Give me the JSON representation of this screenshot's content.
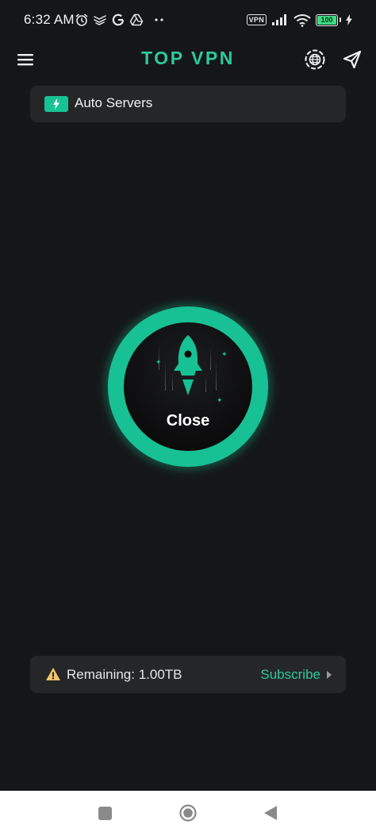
{
  "status_bar": {
    "time": "6:32 AM",
    "left_icons": [
      "alarm-icon",
      "notification-icon",
      "google-icon",
      "drive-icon",
      "more-dots-icon"
    ],
    "vpn_badge": "VPN",
    "battery_level": "100",
    "battery_color": "#3ddc84"
  },
  "header": {
    "title": "TOP VPN",
    "menu_icon": "hamburger-menu-icon",
    "globe_icon": "globe-settings-icon",
    "share_icon": "send-icon"
  },
  "server": {
    "label": "Auto Servers",
    "icon": "bolt-icon"
  },
  "connect": {
    "label": "Close",
    "icon": "rocket-icon"
  },
  "data_usage": {
    "remaining": "Remaining: 1.00TB",
    "subscribe_label": "Subscribe",
    "warning_icon": "warning-icon"
  },
  "colors": {
    "accent": "#17c193",
    "title": "#2ec99a",
    "background": "#151618",
    "card": "#252628"
  }
}
